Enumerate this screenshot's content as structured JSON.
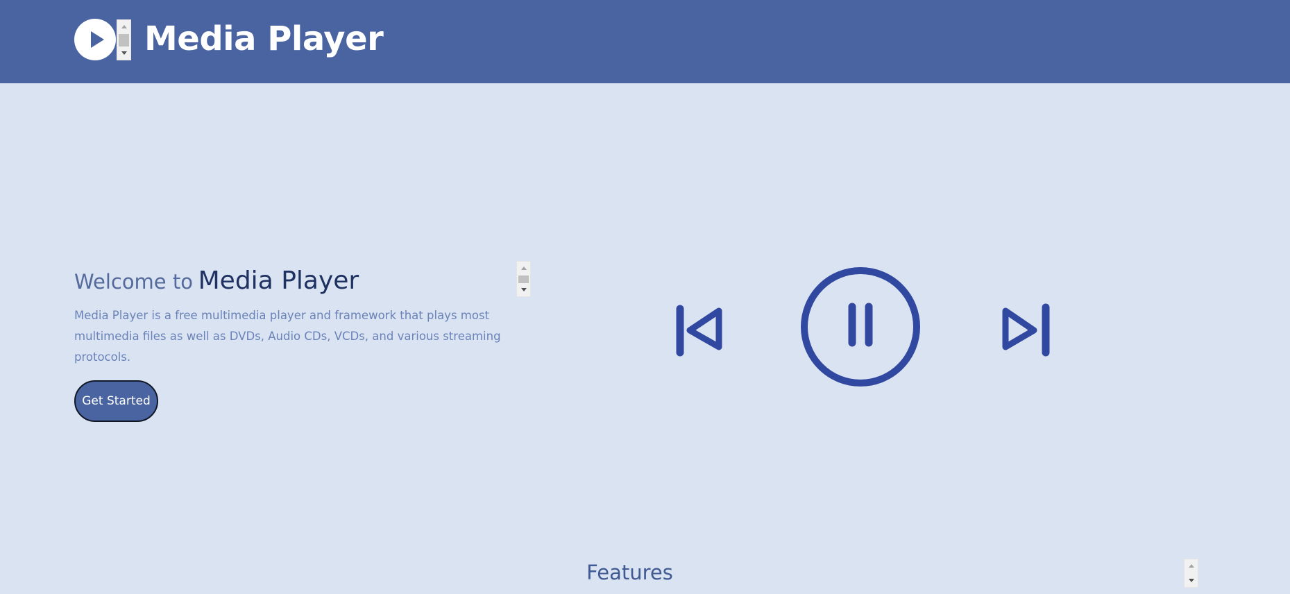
{
  "header": {
    "brand_title": "Media Player",
    "logo_icon": "play-circle-icon"
  },
  "hero": {
    "welcome_prefix": "Welcome to",
    "welcome_name": "Media Player",
    "description": "Media Player is a free multimedia player and framework that plays most multimedia files as well as DVDs, Audio CDs, VCDs, and various streaming protocols.",
    "cta_label": "Get Started"
  },
  "player_controls": {
    "previous_icon": "skip-previous-icon",
    "pause_icon": "pause-circle-icon",
    "next_icon": "skip-next-icon"
  },
  "features": {
    "heading": "Features"
  },
  "colors": {
    "header_bg": "#4a64a1",
    "page_bg": "#dae3f1",
    "accent": "#3148a0",
    "heading_dark": "#1f3161",
    "body_text": "#6a82b8"
  }
}
